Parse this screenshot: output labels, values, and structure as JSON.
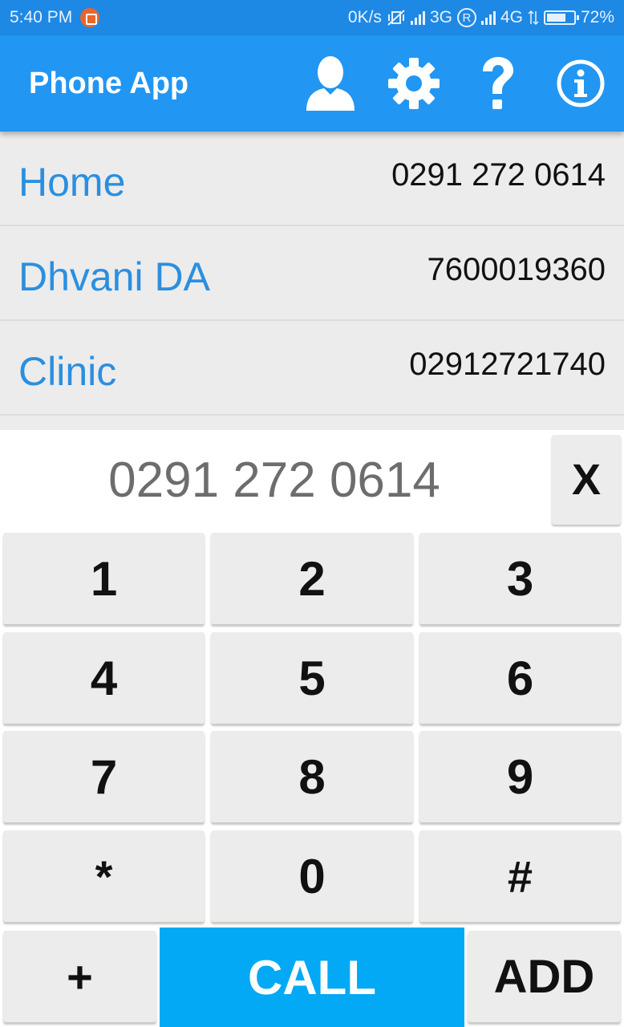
{
  "status_bar": {
    "time": "5:40 PM",
    "net_speed": "0K/s",
    "network_3g": "3G",
    "roaming": "R",
    "network_4g": "4G",
    "battery": "72%",
    "battery_level": 0.72
  },
  "app_bar": {
    "title": "Phone App",
    "icons": [
      "person-icon",
      "gear-icon",
      "help-icon",
      "info-icon"
    ]
  },
  "contacts": [
    {
      "name": "Home",
      "number": "0291 272 0614"
    },
    {
      "name": "Dhvani DA",
      "number": "7600019360"
    },
    {
      "name": "Clinic",
      "number": "02912721740"
    }
  ],
  "dialer": {
    "entry": "0291 272 0614",
    "clear_label": "X",
    "keys": [
      "1",
      "2",
      "3",
      "4",
      "5",
      "6",
      "7",
      "8",
      "9",
      "*",
      "0",
      "#"
    ],
    "plus_label": "+",
    "call_label": "CALL",
    "add_label": "ADD"
  },
  "colors": {
    "app_bar": "#2196f3",
    "status_bar": "#1e88e5",
    "contact_name": "#2b8fe0",
    "call_button": "#03a9f4",
    "key_bg": "#ececec"
  }
}
